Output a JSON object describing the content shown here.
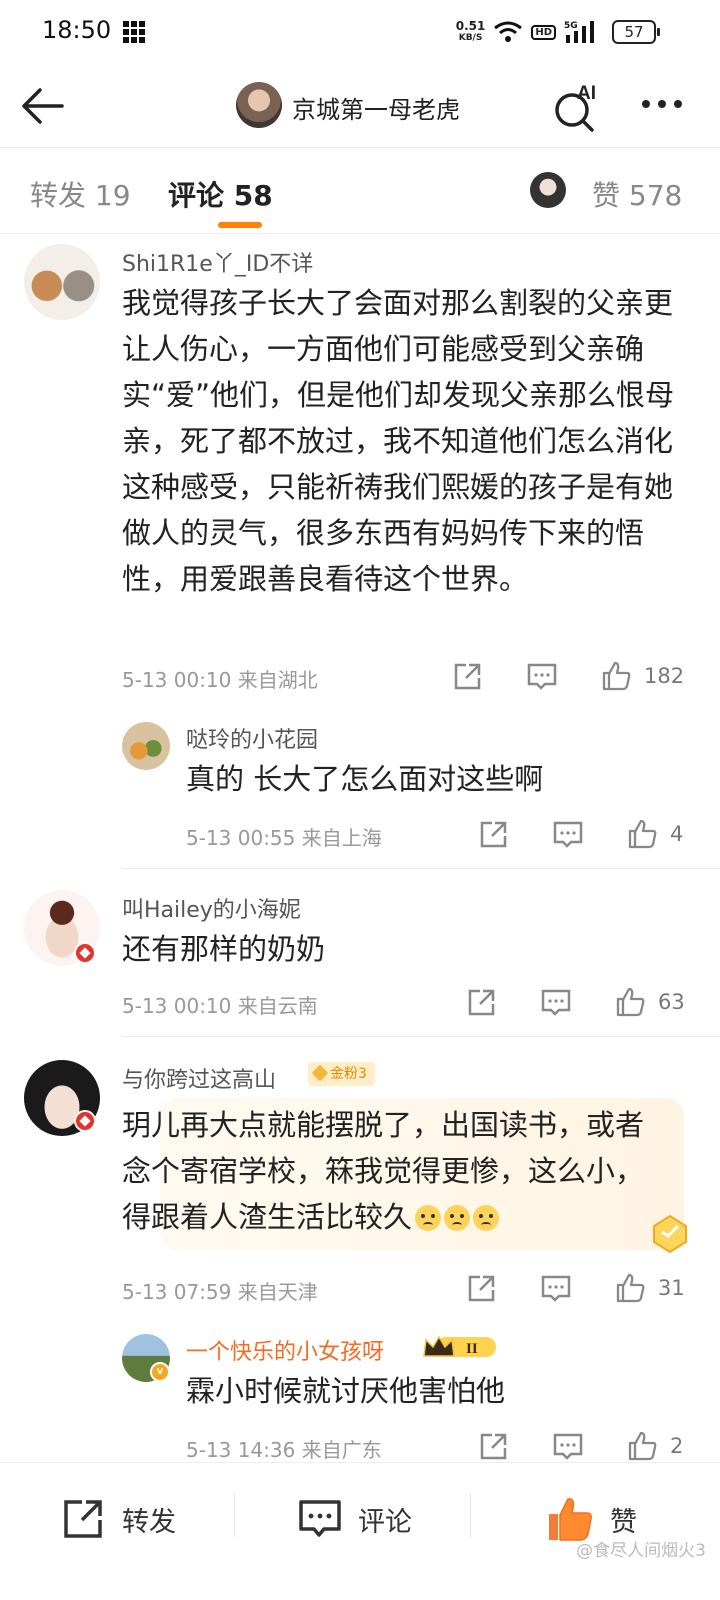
{
  "status_bar": {
    "time": "18:50",
    "net_speed": "0.51",
    "net_unit": "KB/S",
    "hd": "HD",
    "signal": "5G",
    "battery": "57"
  },
  "nav": {
    "title": "京城第一母老虎",
    "ai_label": "AI"
  },
  "tabs": {
    "repost": "转发 19",
    "comments": "评论 58",
    "likes": "赞 578"
  },
  "comments": [
    {
      "user": "Shi1R1e丫_ID不详",
      "text": "我觉得孩子长大了会面对那么割裂的父亲更让人伤心，一方面他们可能感受到父亲确实“爱”他们，但是他们却发现父亲那么恨母亲，死了都不放过，我不知道他们怎么消化这种感受，只能祈祷我们熙媛的孩子是有她做人的灵气，很多东西有妈妈传下来的悟性，用爱跟善良看待这个世界。",
      "meta": "5-13 00:10 来自湖北",
      "likes": "182",
      "reply": {
        "user": "哒玲的小花园",
        "text": "真的 长大了怎么面对这些啊",
        "meta": "5-13 00:55 来自上海",
        "likes": "4"
      }
    },
    {
      "user": "叫Hailey的小海妮",
      "text": "还有那样的奶奶",
      "meta": "5-13 00:10 来自云南",
      "likes": "63"
    },
    {
      "user": "与你跨过这高山",
      "badge": "金粉3",
      "text": "玥儿再大点就能摆脱了，出国读书，或者念个寄宿学校，箖我觉得更惨，这么小，得跟着人渣生活比较久",
      "meta": "5-13 07:59 来自天津",
      "likes": "31",
      "reply": {
        "user": "一个快乐的小女孩呀",
        "crown_level": "II",
        "text": "霖小时候就讨厌他害怕他",
        "meta": "5-13 14:36 来自广东",
        "likes": "2"
      }
    }
  ],
  "bottom_bar": {
    "repost": "转发",
    "comment": "评论",
    "like": "赞"
  },
  "watermark": "@食尽人间烟火3",
  "colors": {
    "accent": "#ff8200",
    "name_orange": "#f36c21",
    "meta_gray": "#999999"
  }
}
